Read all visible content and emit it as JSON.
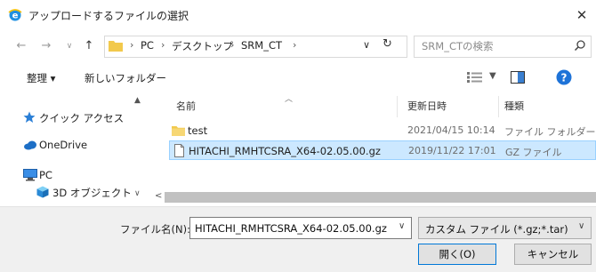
{
  "window": {
    "title": "アップロードするファイルの選択",
    "close_glyph": "✕"
  },
  "address": {
    "crumbs": [
      "PC",
      "デスクトップ",
      "SRM_CT"
    ],
    "separator": "›",
    "search_placeholder": "SRM_CTの検索"
  },
  "toolbar": {
    "organize_label": "整理 ▾",
    "new_folder_label": "新しいフォルダー",
    "help_glyph": "?"
  },
  "nav": {
    "items": [
      {
        "label": "クイック アクセス",
        "icon": "star-icon"
      },
      {
        "label": "OneDrive",
        "icon": "cloud-icon"
      },
      {
        "label": "PC",
        "icon": "computer-icon"
      },
      {
        "label": "3D オブジェクト",
        "icon": "cube-icon"
      }
    ]
  },
  "filelist": {
    "columns": [
      "名前",
      "更新日時",
      "種類"
    ],
    "rows": [
      {
        "name": "test",
        "date": "2021/04/15 10:14",
        "type": "ファイル フォルダー",
        "icon": "folder-icon",
        "selected": false
      },
      {
        "name": "HITACHI_RMHTCSRA_X64-02.05.00.gz",
        "date": "2019/11/22 17:01",
        "type": "GZ ファイル",
        "icon": "file-icon",
        "selected": true
      }
    ]
  },
  "footer": {
    "filename_label": "ファイル名(N):",
    "filename_value": "HITACHI_RMHTCSRA_X64-02.05.00.gz",
    "filter_value": "カスタム ファイル (*.gz;*.tar)",
    "open_label": "開く(O)",
    "cancel_label": "キャンセル"
  },
  "colors": {
    "selection_bg": "#cce8ff",
    "accent": "#0078d7",
    "folder": "#f2c94c",
    "star": "#2b7fd6",
    "help": "#1e73d8"
  }
}
